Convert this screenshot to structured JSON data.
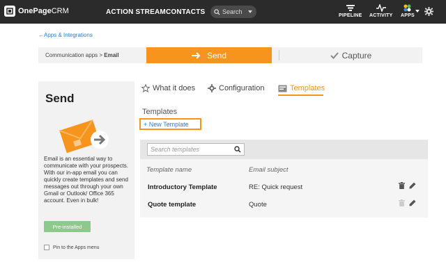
{
  "topbar": {
    "logo_bold": "OnePage",
    "logo_light": "CRM",
    "nav": [
      "ACTION STREAM",
      "CONTACTS"
    ],
    "search_label": "Search",
    "icons": [
      {
        "label": "PIPELINE",
        "icon": "pipeline-icon"
      },
      {
        "label": "ACTIVITY",
        "icon": "activity-icon"
      },
      {
        "label": "APPS",
        "icon": "apps-icon"
      }
    ]
  },
  "breadcrumb": {
    "back": "←Apps & Integrations"
  },
  "wizard": {
    "crumb_prefix": "Communication apps > ",
    "crumb_current": "Email",
    "step_send": "Send",
    "step_capture": "Capture"
  },
  "card": {
    "title": "Send",
    "description": "Email is an essential way to communicate with your prospects. With our in-app email you can quickly create templates and send messages out through your own Gmail or Outlook/ Office 365 account. Even in bulk!",
    "button": "Pre-installed",
    "pin_label": "Pin to the Apps menu"
  },
  "tabs": [
    {
      "label": "What it does",
      "icon": "star-icon"
    },
    {
      "label": "Configuration",
      "icon": "gear-icon"
    },
    {
      "label": "Templates",
      "icon": "template-icon",
      "active": true
    }
  ],
  "templates": {
    "section_title": "Templates",
    "new_button": "+ New Template",
    "search_placeholder": "Search templates",
    "columns": [
      "Template name",
      "Email subject"
    ],
    "rows": [
      {
        "name": "Introductory Template",
        "subject": "RE: Quick request"
      },
      {
        "name": "Quote template",
        "subject": "Quote"
      }
    ]
  },
  "colors": {
    "accent": "#f7941d",
    "link": "#2a7fd4",
    "topbar": "#2b2b2b",
    "success": "#8cc98b"
  }
}
